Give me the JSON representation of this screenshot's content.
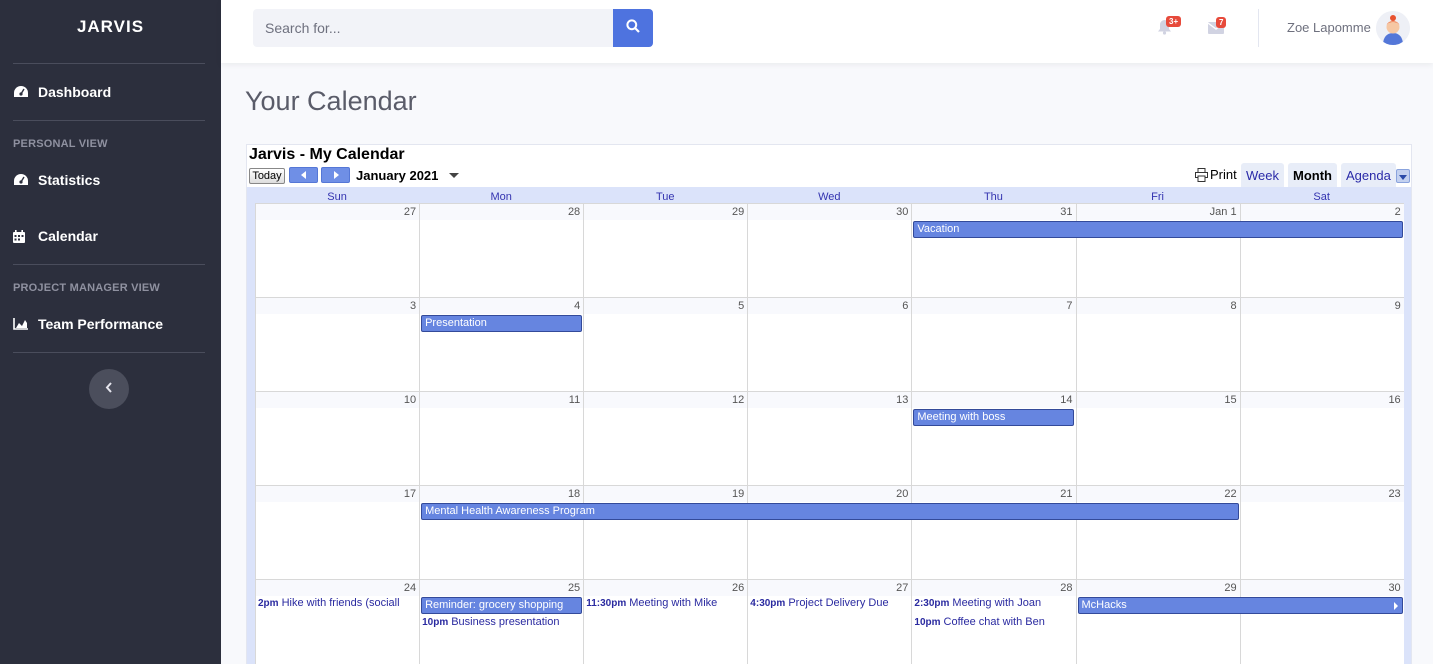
{
  "sidebar": {
    "brand": "JARVIS",
    "dashboard": "Dashboard",
    "heading_personal": "PERSONAL VIEW",
    "statistics": "Statistics",
    "calendar": "Calendar",
    "heading_pm": "PROJECT MANAGER VIEW",
    "team_performance": "Team Performance"
  },
  "topbar": {
    "search_placeholder": "Search for...",
    "alerts_badge": "3+",
    "messages_badge": "7",
    "user_name": "Zoe Lapomme"
  },
  "page": {
    "title": "Your Calendar"
  },
  "calendar": {
    "title": "Jarvis - My Calendar",
    "today_label": "Today",
    "month_label": "January 2021",
    "print_label": "Print",
    "views": [
      "Week",
      "Month",
      "Agenda"
    ],
    "active_view": "Month",
    "weekdays": [
      "Sun",
      "Mon",
      "Tue",
      "Wed",
      "Thu",
      "Fri",
      "Sat"
    ],
    "weeks": [
      [
        "27",
        "28",
        "29",
        "30",
        "31",
        "Jan 1",
        "2"
      ],
      [
        "3",
        "4",
        "5",
        "6",
        "7",
        "8",
        "9"
      ],
      [
        "10",
        "11",
        "12",
        "13",
        "14",
        "15",
        "16"
      ],
      [
        "17",
        "18",
        "19",
        "20",
        "21",
        "22",
        "23"
      ],
      [
        "24",
        "25",
        "26",
        "27",
        "28",
        "29",
        "30"
      ]
    ],
    "bar_events": [
      {
        "week": 0,
        "start": 4,
        "span": 3,
        "label": "Vacation"
      },
      {
        "week": 1,
        "start": 1,
        "span": 1,
        "label": "Presentation"
      },
      {
        "week": 2,
        "start": 4,
        "span": 1,
        "label": "Meeting with boss"
      },
      {
        "week": 3,
        "start": 1,
        "span": 5,
        "label": "Mental Health Awareness Program"
      },
      {
        "week": 4,
        "start": 1,
        "span": 1,
        "label": "Reminder: grocery shopping"
      },
      {
        "week": 4,
        "start": 5,
        "span": 2,
        "label": "McHacks"
      }
    ],
    "timed_events": [
      {
        "week": 4,
        "day": 0,
        "row": 0,
        "time": "2pm",
        "label": "Hike with friends (sociall"
      },
      {
        "week": 4,
        "day": 1,
        "row": 1,
        "time": "10pm",
        "label": "Business presentation"
      },
      {
        "week": 4,
        "day": 2,
        "row": 0,
        "time": "11:30pm",
        "label": "Meeting with Mike"
      },
      {
        "week": 4,
        "day": 3,
        "row": 0,
        "time": "4:30pm",
        "label": "Project Delivery Due"
      },
      {
        "week": 4,
        "day": 4,
        "row": 0,
        "time": "2:30pm",
        "label": "Meeting with Joan"
      },
      {
        "week": 4,
        "day": 4,
        "row": 1,
        "time": "10pm",
        "label": "Coffee chat with Ben"
      }
    ]
  },
  "colors": {
    "sidebar_bg": "#2c2f3d",
    "primary": "#4e73df",
    "event_bar": "#6685e0",
    "badge": "#e74a3b"
  }
}
